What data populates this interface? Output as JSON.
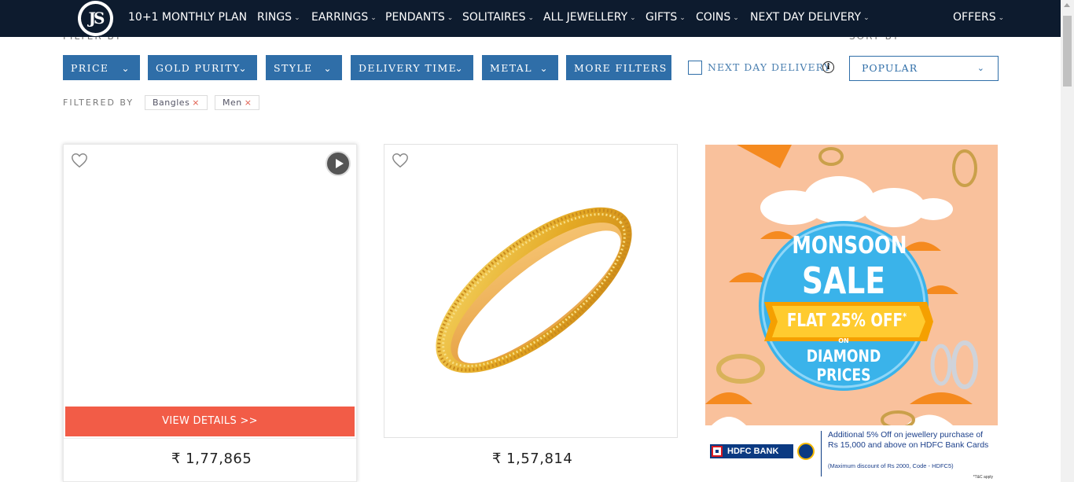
{
  "nav": {
    "logo_text": "JS",
    "items": [
      {
        "label": "10+1 MONTHLY PLAN",
        "chevron": false
      },
      {
        "label": "RINGS",
        "chevron": true
      },
      {
        "label": "EARRINGS",
        "chevron": true
      },
      {
        "label": "PENDANTS",
        "chevron": true
      },
      {
        "label": "SOLITAIRES",
        "chevron": true
      },
      {
        "label": "ALL JEWELLERY",
        "chevron": true
      },
      {
        "label": "GIFTS",
        "chevron": true
      },
      {
        "label": "COINS",
        "chevron": true
      },
      {
        "label": "NEXT DAY DELIVERY",
        "chevron": true
      },
      {
        "label": "OFFERS",
        "chevron": true
      }
    ]
  },
  "filters": {
    "section_label": "FILTER BY",
    "buttons": [
      "PRICE",
      "GOLD PURITY",
      "STYLE",
      "DELIVERY TIME",
      "METAL",
      "MORE FILTERS"
    ],
    "next_day_delivery_label": "NEXT DAY DELIVERY",
    "next_day_delivery_checked": false,
    "info_icon": "i"
  },
  "sort": {
    "section_label": "SORT BY",
    "selected": "POPULAR"
  },
  "filtered_by": {
    "label": "FILTERED BY",
    "chips": [
      "Bangles",
      "Men"
    ],
    "remove_glyph": "×"
  },
  "products": [
    {
      "price": "₹ 1,77,865",
      "view_details": "VIEW DETAILS >>",
      "has_video": true
    },
    {
      "price": "₹ 1,57,814"
    }
  ],
  "banner": {
    "line1": "MONSOON",
    "line2": "SALE",
    "ribbon": "FLAT 25% OFF",
    "ribbon_sup": "*",
    "on": "ON",
    "line3": "DIAMOND PRICES",
    "bank_name": "HDFC BANK",
    "offer_text": "Additional 5% Off on jewellery purchase of Rs 15,000 and above on HDFC Bank Cards",
    "offer_small": "(Maximum discount of Rs 2000, Code - HDFC5)",
    "tc": "*T&C apply"
  },
  "colors": {
    "nav_bg": "#0d1b2e",
    "filter_blue": "#2f6ea8",
    "view_details": "#f25c47",
    "banner_bg": "#f9c19c",
    "gold": "#e4b02a"
  }
}
